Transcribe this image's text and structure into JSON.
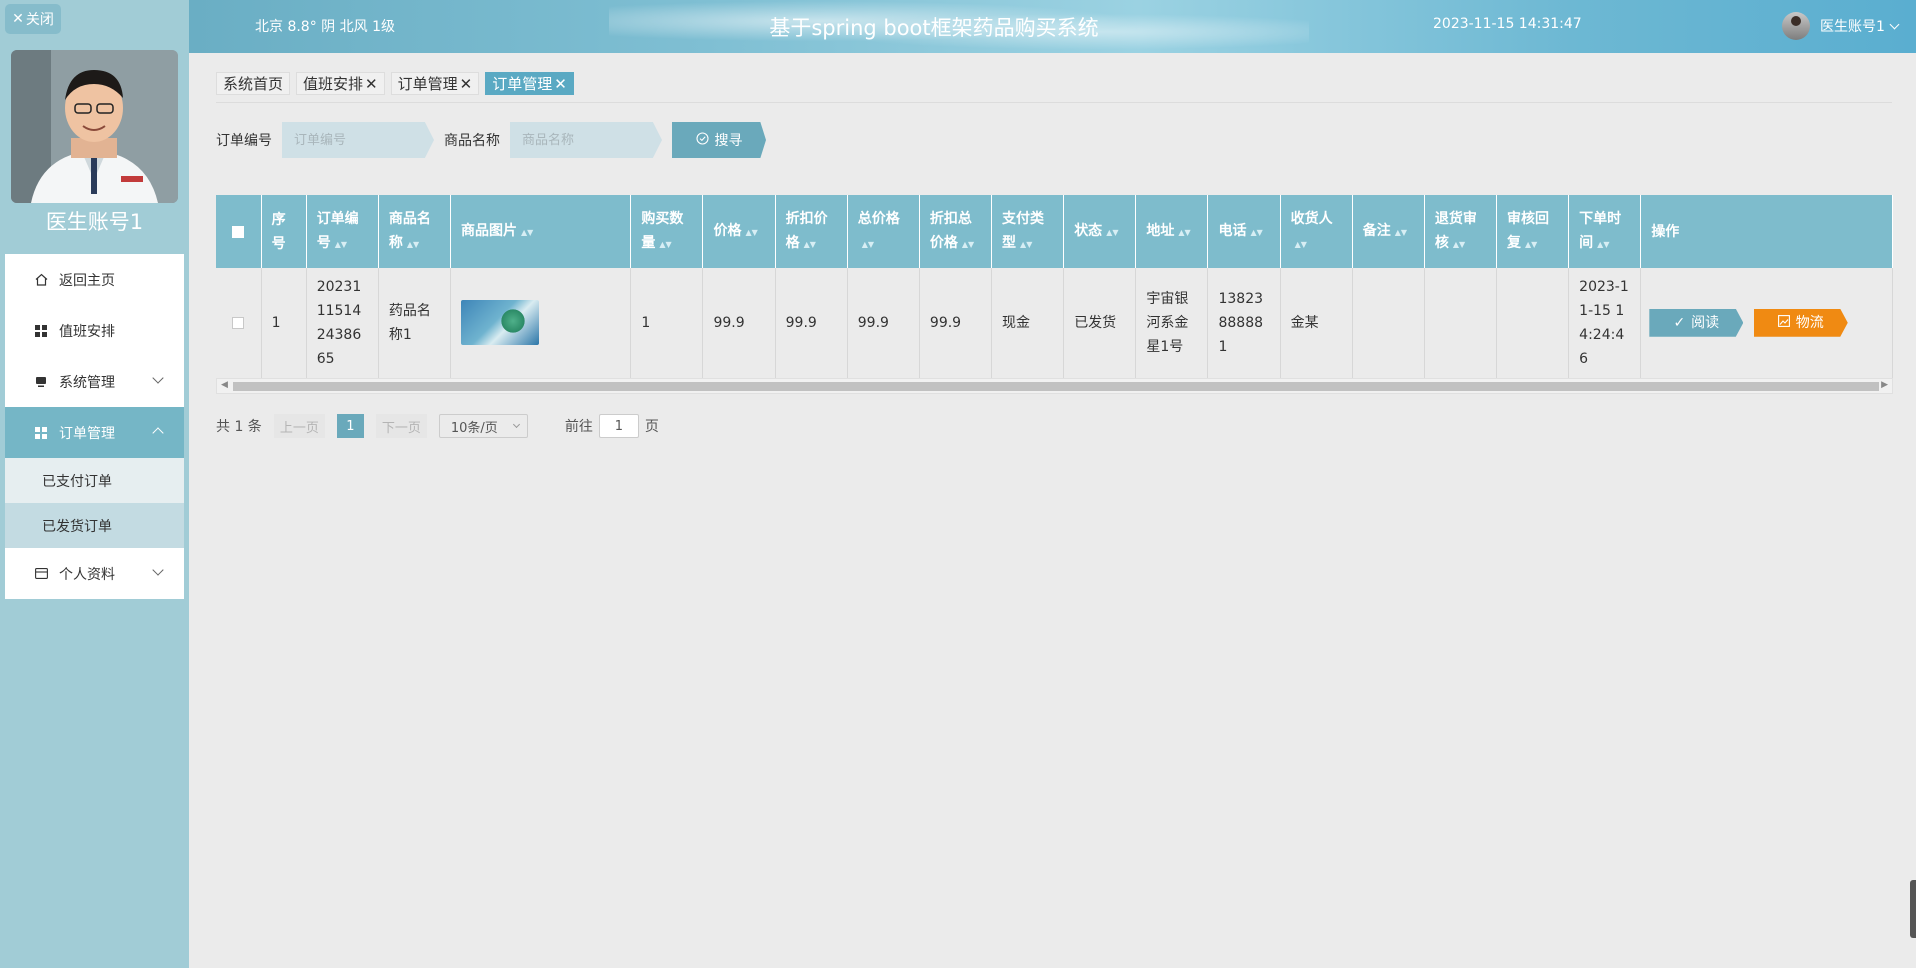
{
  "sidebar": {
    "close_label": "关闭",
    "username": "医生账号1",
    "menu": [
      {
        "label": "返回主页",
        "icon": "home-icon"
      },
      {
        "label": "值班安排",
        "icon": "grid-icon"
      },
      {
        "label": "系统管理",
        "icon": "monitor-icon"
      },
      {
        "label": "订单管理",
        "icon": "grid-icon"
      },
      {
        "label": "个人资料",
        "icon": "card-icon"
      }
    ],
    "submenu": [
      "已支付订单",
      "已发货订单"
    ]
  },
  "header": {
    "weather": "北京  8.8°  阴  北风  1级",
    "title": "基于spring boot框架药品购买系统",
    "datetime": "2023-11-15 14:31:47",
    "user": "医生账号1"
  },
  "tabs": [
    "系统首页",
    "值班安排",
    "订单管理",
    "订单管理"
  ],
  "search": {
    "order_label": "订单编号",
    "order_placeholder": "订单编号",
    "product_label": "商品名称",
    "product_placeholder": "商品名称",
    "button": "搜寻"
  },
  "table": {
    "headers": [
      "序号",
      "订单编号",
      "商品名称",
      "商品图片",
      "购买数量",
      "价格",
      "折扣价格",
      "总价格",
      "折扣总价格",
      "支付类型",
      "状态",
      "地址",
      "电话",
      "收货人",
      "备注",
      "退货审核",
      "审核回复",
      "下单时间",
      "操作"
    ],
    "rows": [
      {
        "index": "1",
        "order_no": "20231115142438665",
        "product_name": "药品名称1",
        "quantity": "1",
        "price": "99.9",
        "discount_price": "99.9",
        "total": "99.9",
        "discount_total": "99.9",
        "pay_type": "现金",
        "status": "已发货",
        "address": "宇宙银河系金星1号",
        "phone": "13823888881",
        "receiver": "金某",
        "remark": "",
        "return_review": "",
        "review_reply": "",
        "order_time": "2023-11-15 14:24:46",
        "read_label": "阅读",
        "logistics_label": "物流"
      }
    ]
  },
  "pagination": {
    "total": "共 1 条",
    "prev": "上一页",
    "current": "1",
    "next": "下一页",
    "page_size": "10条/页",
    "goto": "前往",
    "goto_value": "1",
    "page_unit": "页"
  }
}
